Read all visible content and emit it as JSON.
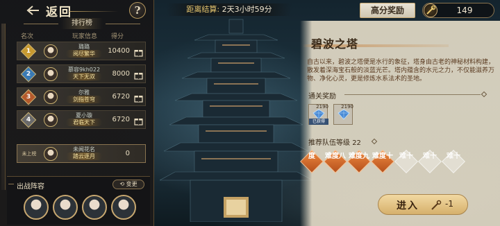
{
  "nav": {
    "back_label": "返回",
    "help_label": "?"
  },
  "countdown": {
    "label": "距离结算:",
    "value": "2天3小时59分"
  },
  "top_right": {
    "reward_button": "高分奖励",
    "currency_amount": "149"
  },
  "leaderboard": {
    "title": "排行榜",
    "columns": {
      "rank": "名次",
      "player": "玩家信息",
      "score": "得分"
    },
    "rows": [
      {
        "rank": "1",
        "name": "璐璐",
        "title": "阅尽繁华",
        "score": "10400",
        "badge_color": "#c89a30"
      },
      {
        "rank": "2",
        "name": "慕容9kh022",
        "title": "天下无双",
        "score": "8000",
        "badge_color": "#3a7ab4"
      },
      {
        "rank": "3",
        "name": "尔雅",
        "title": "剑指苍穹",
        "score": "6720",
        "badge_color": "#b45a2c"
      },
      {
        "rank": "4",
        "name": "夏小璇",
        "title": "君临天下",
        "score": "6720",
        "badge_color": "#6a6a6a"
      }
    ],
    "self": {
      "rank_label": "未上榜",
      "name": "未闻花名",
      "title": "踏云逐月",
      "score": "0"
    }
  },
  "lineup": {
    "title": "出战阵容",
    "change_label": "变更"
  },
  "tower": {
    "name": "碧波之塔",
    "description": "自古以来，碧波之塔便是水行的象征，塔身由古老的神秘材料构建，散发着深海宝石般的淡蓝光芒。塔内蕴含的水元之力，不仅能滋养万物、净化心灵，更是修炼水系法术的圣地。"
  },
  "clear_rewards": {
    "title": "通关奖励",
    "items": [
      {
        "count": "2190",
        "tag": "已获得"
      },
      {
        "count": "2190",
        "tag": ""
      }
    ]
  },
  "recommend": {
    "label": "推荐队伍等级",
    "value": "22"
  },
  "difficulties": [
    {
      "text": "度",
      "state": "done"
    },
    {
      "text": "难度八",
      "state": "done"
    },
    {
      "text": "难度九",
      "state": "done"
    },
    {
      "text": "难度十",
      "state": "done"
    },
    {
      "text": "难十",
      "state": "locked"
    },
    {
      "text": "难十",
      "state": "locked"
    },
    {
      "text": "难十",
      "state": "locked"
    }
  ],
  "enter": {
    "label": "进入",
    "cost": "-1"
  },
  "palette": {
    "accent_gold": "#c8a870",
    "diff_orange": "#d06a2c",
    "panel_bg": "#e2dac6"
  }
}
